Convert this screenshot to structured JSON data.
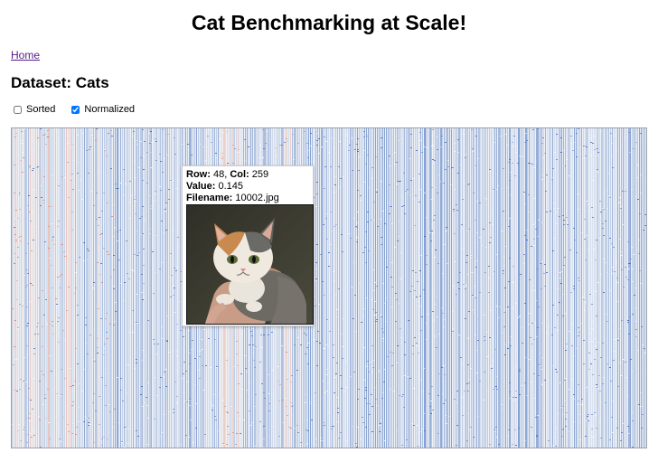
{
  "page": {
    "title": "Cat Benchmarking at Scale!",
    "home_link": "Home",
    "dataset_heading": "Dataset: Cats"
  },
  "controls": {
    "sorted": {
      "label": "Sorted",
      "checked": false
    },
    "normalized": {
      "label": "Normalized",
      "checked": true
    }
  },
  "colors": {
    "cold": "#2f5fb3",
    "mid": "#eef1f6",
    "warm": "#d9775b",
    "link": "#551a8b"
  },
  "tooltip": {
    "row_label": "Row:",
    "row_value": "48",
    "col_label": "Col:",
    "col_value": "259",
    "value_label": "Value:",
    "value_value": "0.145",
    "filename_label": "Filename:",
    "filename_value": "10002.jpg",
    "image_icon": "cat-photo"
  }
}
